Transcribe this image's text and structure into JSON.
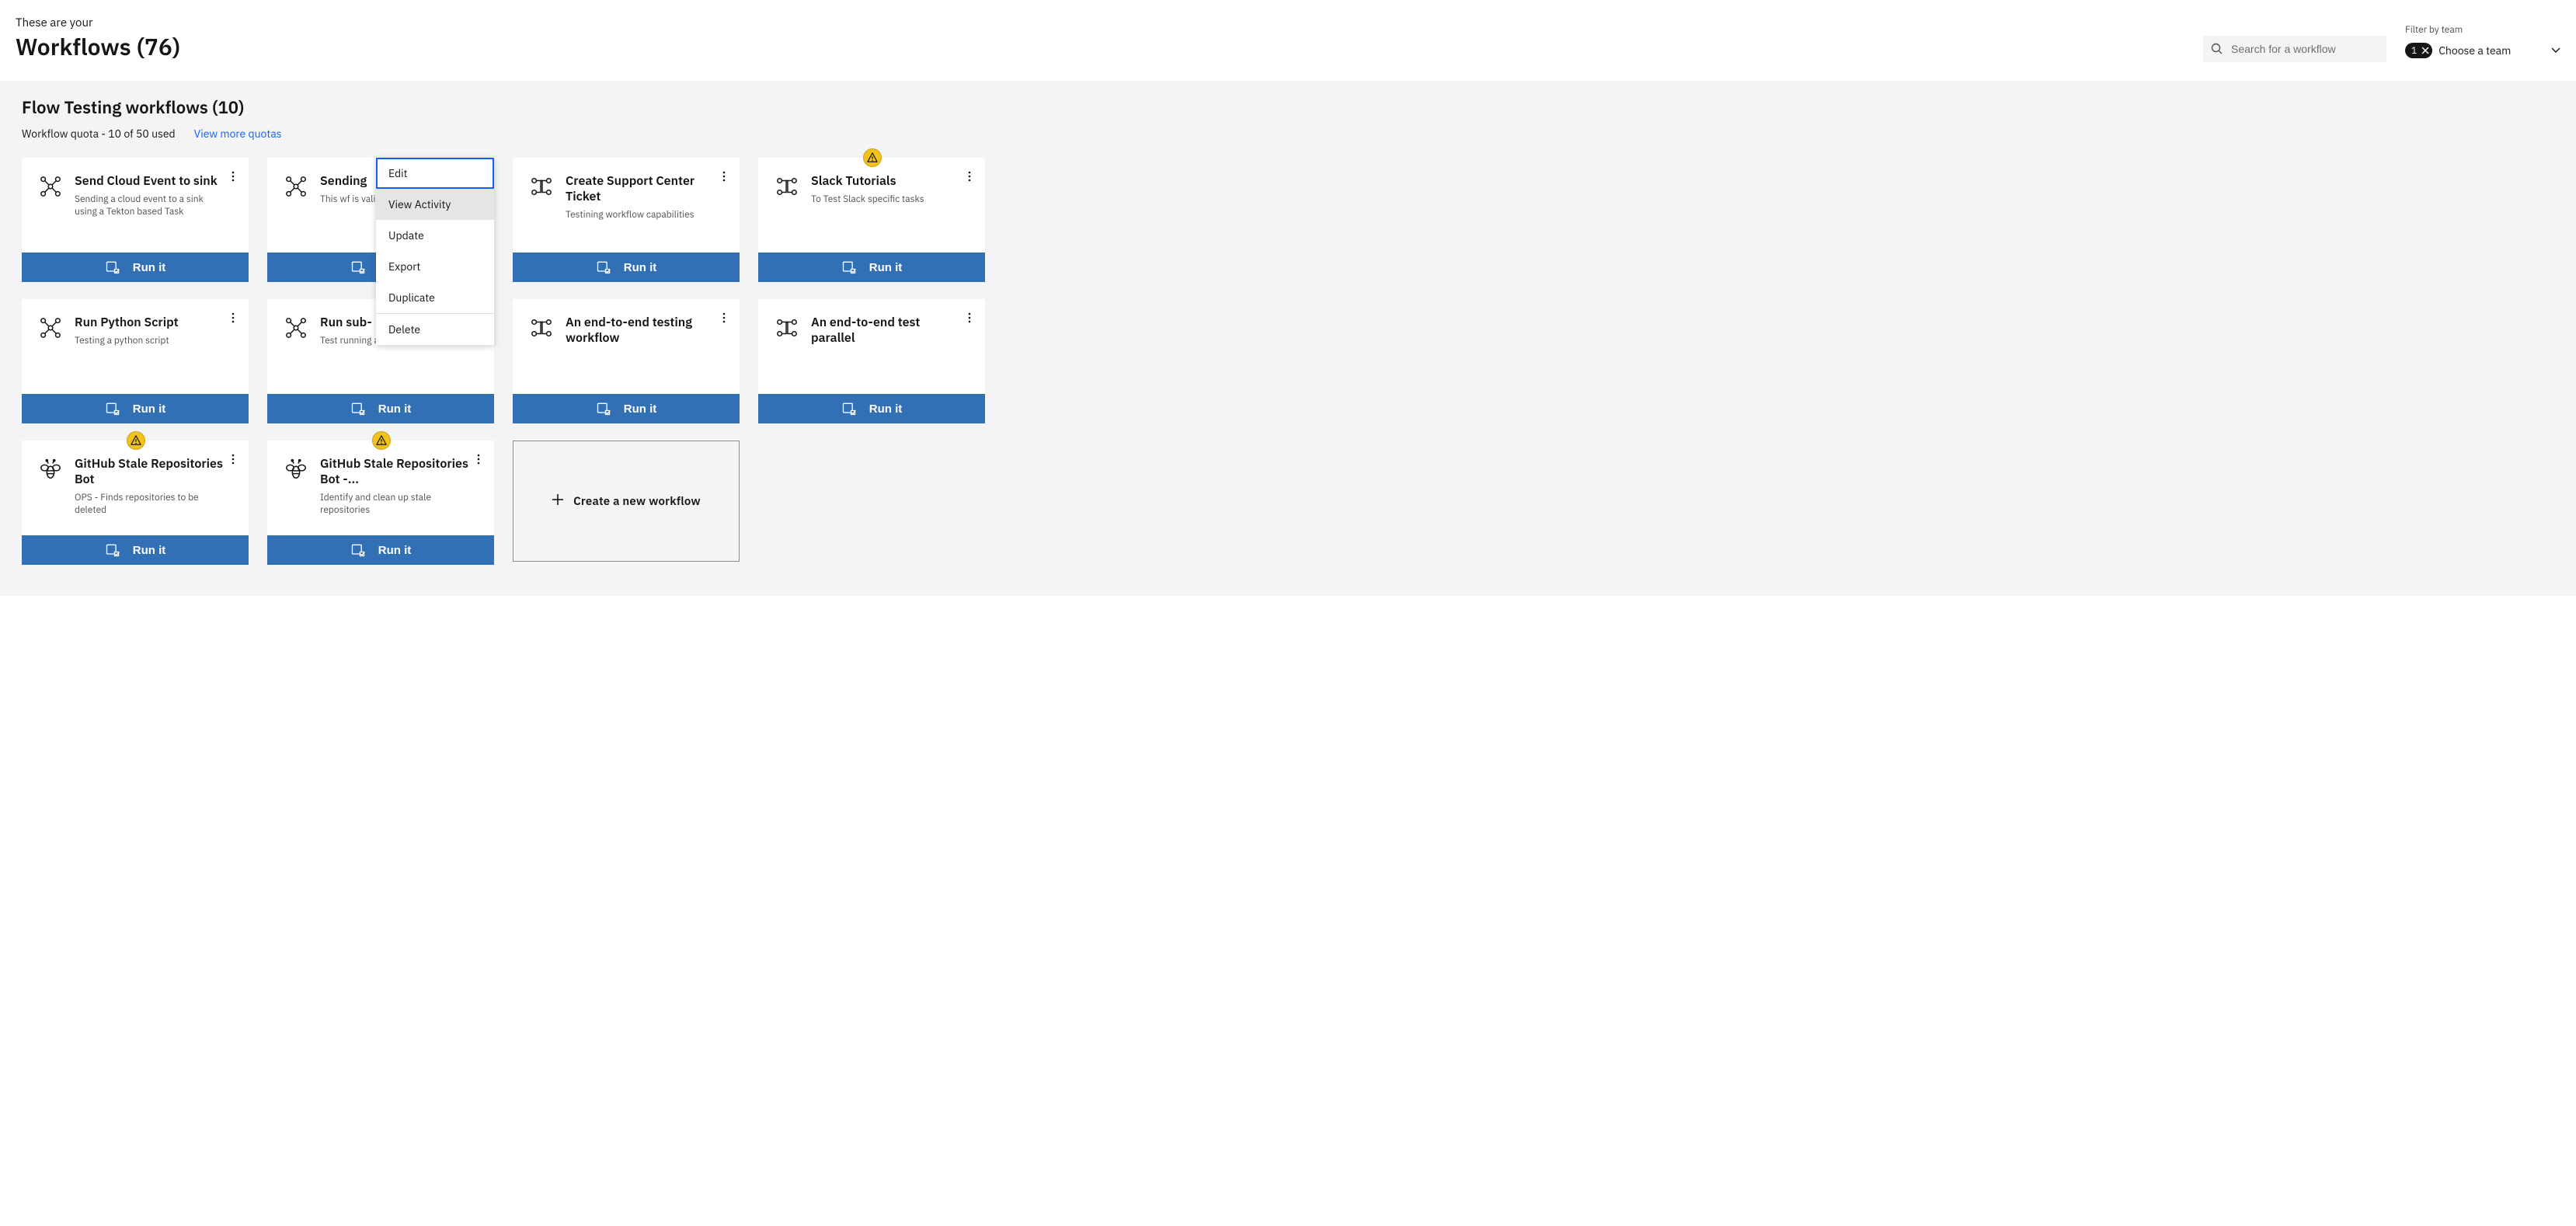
{
  "header": {
    "subtitle": "These are your",
    "title": "Workflows (76)"
  },
  "search": {
    "placeholder": "Search for a workflow"
  },
  "filter": {
    "label": "Filter by team",
    "chip_count": "1",
    "placeholder": "Choose a team"
  },
  "section": {
    "title": "Flow Testing workflows (10)",
    "quota": "Workflow quota - 10 of 50 used",
    "quota_link": "View more quotas"
  },
  "run_label": "Run it",
  "new_card_label": "Create a new workflow",
  "cards": [
    {
      "title": "Send Cloud Event to sink",
      "desc": "Sending a cloud event to a sink using a Tekton based Task",
      "icon": "graph"
    },
    {
      "title": "Sending ",
      "desc": "This wf is vali\ncapabilities",
      "icon": "graph"
    },
    {
      "title": "Create Support Center Ticket",
      "desc": "Testining workflow capabilities",
      "icon": "flow"
    },
    {
      "title": "Slack Tutorials",
      "desc": "To Test Slack specific tasks",
      "icon": "flow",
      "warn": true
    },
    {
      "title": "Run Python Script",
      "desc": "Testing a python script",
      "icon": "graph"
    },
    {
      "title": "Run sub-",
      "desc": "Test running a",
      "icon": "graph"
    },
    {
      "title": "An end-to-end testing workflow",
      "desc": "",
      "icon": "flow"
    },
    {
      "title": "An end-to-end test parallel",
      "desc": "",
      "icon": "flow"
    },
    {
      "title": "GitHub Stale Repositories Bot",
      "desc": "OPS - Finds repositories to be deleted",
      "icon": "bee",
      "warn": true
    },
    {
      "title": "GitHub Stale Repositories Bot -...",
      "desc": "Identify and clean up stale repositories",
      "icon": "bee",
      "warn": true
    }
  ],
  "menu": {
    "items": [
      "Edit",
      "View Activity",
      "Update",
      "Export",
      "Duplicate",
      "Delete"
    ]
  }
}
